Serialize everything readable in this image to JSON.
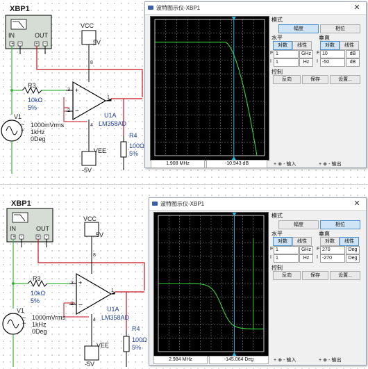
{
  "panels": [
    {
      "schematic": {
        "instrument": "XBP1",
        "port_in": "IN",
        "port_out": "OUT",
        "vcc": "VCC",
        "vcc_val": "5V",
        "vee": "VEE",
        "vee_val": "-5V",
        "r3_name": "R3",
        "r3_val": "10kΩ",
        "r3_tol": "5%",
        "v1_name": "V1",
        "v1_amp": "1000mVrms",
        "v1_freq": "1kHz",
        "v1_phase": "0Deg",
        "opamp_name": "U1A",
        "opamp_part": "LM358AD",
        "r4_name": "R4",
        "r4_val": "100Ω",
        "r4_tol": "5%",
        "pin3": "3",
        "pin2": "2",
        "pin8": "8",
        "pin4": "4",
        "pin1": "1"
      },
      "window": {
        "title": "波特图示仪-XBP1",
        "close": "✕",
        "mode_label": "模式",
        "magnitude": "幅度",
        "phase": "相位",
        "active_mode": "magnitude",
        "horizontal": "水平",
        "vertical": "垂直",
        "log": "对数",
        "linear": "线性",
        "h_f": "F",
        "h_i": "I",
        "h_final": "1",
        "h_final_unit": "GHz",
        "h_initial": "1",
        "h_initial_unit": "Hz",
        "v_final": "10",
        "v_final_unit": "dB",
        "v_initial": "-50",
        "v_initial_unit": "dB",
        "control": "控制",
        "reverse": "反向",
        "save": "保存",
        "settings": "设置...",
        "readout_freq": "1.908 MHz",
        "readout_val": "-10.943 dB",
        "input": "输入",
        "output": "输出",
        "plus": "+",
        "minus": "-"
      },
      "trace": {
        "type": "magnitude",
        "passband_db": 0,
        "cursor_freq": "1.908 MHz",
        "cursor_val_db": -10.943,
        "color": "#3ad23a"
      }
    },
    {
      "schematic": {
        "instrument": "XBP1",
        "port_in": "IN",
        "port_out": "OUT",
        "vcc": "VCC",
        "vcc_val": "5V",
        "vee": "VEE",
        "vee_val": "-5V",
        "r3_name": "R3",
        "r3_val": "10kΩ",
        "r3_tol": "5%",
        "v1_name": "V1",
        "v1_amp": "1000mVrms",
        "v1_freq": "1kHz",
        "v1_phase": "0Deg",
        "opamp_name": "U1A",
        "opamp_part": "LM358AD",
        "r4_name": "R4",
        "r4_val": "100Ω",
        "r4_tol": "5%",
        "pin3": "3",
        "pin2": "2",
        "pin8": "8",
        "pin4": "4",
        "pin1": "1"
      },
      "window": {
        "title": "波特图示仪-XBP1",
        "close": "✕",
        "mode_label": "模式",
        "magnitude": "幅度",
        "phase": "相位",
        "active_mode": "phase",
        "horizontal": "水平",
        "vertical": "垂直",
        "log": "对数",
        "linear": "线性",
        "h_f": "F",
        "h_i": "I",
        "h_final": "1",
        "h_final_unit": "GHz",
        "h_initial": "1",
        "h_initial_unit": "Hz",
        "v_final": "270",
        "v_final_unit": "Deg",
        "v_initial": "-270",
        "v_initial_unit": "Deg",
        "control": "控制",
        "reverse": "反向",
        "save": "保存",
        "settings": "设置...",
        "readout_freq": "2.984 MHz",
        "readout_val": "-145.064 Deg",
        "input": "输入",
        "output": "输出",
        "plus": "+",
        "minus": "-"
      },
      "trace": {
        "type": "phase",
        "cursor_freq": "2.984 MHz",
        "cursor_val_deg": -145.064,
        "color": "#3ad23a"
      }
    }
  ],
  "colors": {
    "wire_red": "#c8101e",
    "wire_green": "#3ab53a",
    "wire_black": "#000000",
    "label_blue": "#1f3f9c",
    "trace": "#3ad23a",
    "cursor": "#26b7e0"
  }
}
